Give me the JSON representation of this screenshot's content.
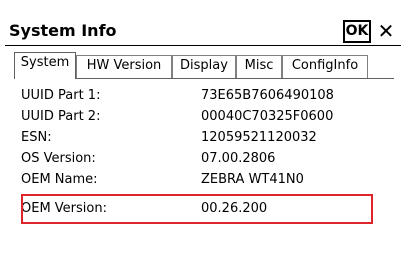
{
  "window": {
    "title": "System Info",
    "ok_label": "OK",
    "close_label": "✕"
  },
  "tabs": [
    {
      "label": "System",
      "active": true
    },
    {
      "label": "HW Version",
      "active": false
    },
    {
      "label": "Display",
      "active": false
    },
    {
      "label": "Misc",
      "active": false
    },
    {
      "label": "ConfigInfo",
      "active": false
    }
  ],
  "info": [
    {
      "label": "UUID Part 1:",
      "value": "73E65B7606490108"
    },
    {
      "label": "UUID Part 2:",
      "value": "00040C70325F0600"
    },
    {
      "label": "ESN:",
      "value": "12059521120032"
    },
    {
      "label": "OS Version:",
      "value": "07.00.2806"
    },
    {
      "label": "OEM Name:",
      "value": "ZEBRA WT41N0"
    },
    {
      "label": "OEM Version:",
      "value": "00.26.200"
    }
  ],
  "colors": {
    "highlight": "#e0242c"
  }
}
